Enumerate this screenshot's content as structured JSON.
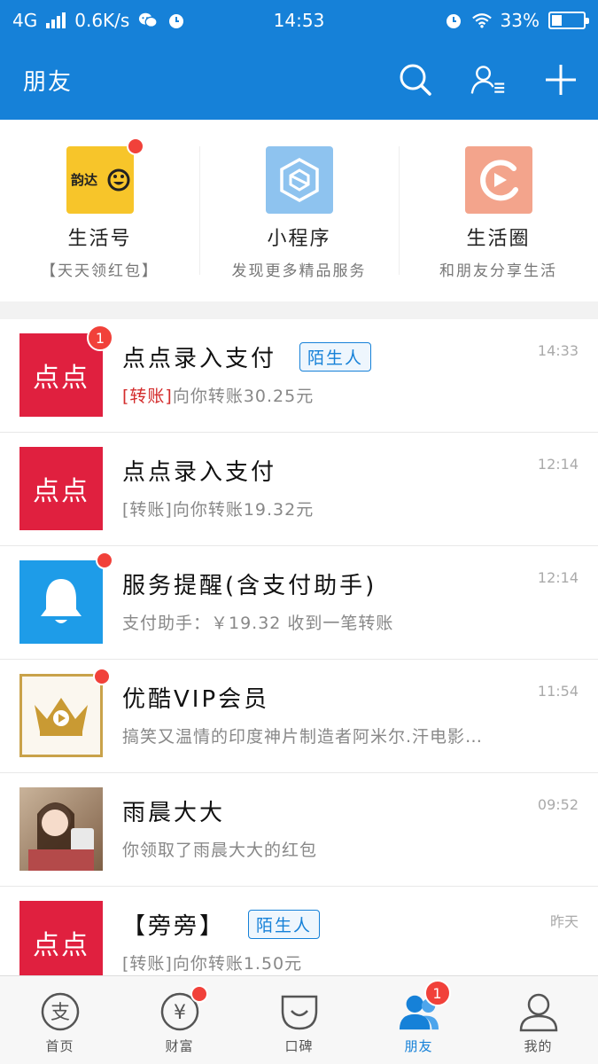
{
  "status_bar": {
    "network": "4G",
    "speed": "0.6K/s",
    "time": "14:53",
    "battery_percent": "33%",
    "battery_level": 0.33
  },
  "header": {
    "title": "朋友"
  },
  "top_grid": [
    {
      "title": "生活号",
      "subtitle": "【天天领红包】",
      "icon": "yunda-logo",
      "has_dot": true
    },
    {
      "title": "小程序",
      "subtitle": "发现更多精品服务",
      "icon": "mini-program-icon",
      "has_dot": false
    },
    {
      "title": "生活圈",
      "subtitle": "和朋友分享生活",
      "icon": "life-circle-icon",
      "has_dot": false
    }
  ],
  "chats": [
    {
      "name": "点点录入支付",
      "tag": "陌生人",
      "msg_prefix": "[转账]",
      "msg": "向你转账30.25元",
      "time": "14:33",
      "badge": "1",
      "avatar_text": "点点"
    },
    {
      "name": "点点录入支付",
      "tag": "",
      "msg_prefix": "",
      "msg": "[转账]向你转账19.32元",
      "time": "12:14",
      "badge": "",
      "avatar_text": "点点"
    },
    {
      "name": "服务提醒(含支付助手)",
      "tag": "",
      "msg_prefix": "",
      "msg": "支付助手：￥19.32 收到一笔转账",
      "time": "12:14",
      "badge": "",
      "avatar_text": ""
    },
    {
      "name": "优酷VIP会员",
      "tag": "",
      "msg_prefix": "",
      "msg": "搞笑又温情的印度神片制造者阿米尔.汗电影…",
      "time": "11:54",
      "badge": "",
      "avatar_text": ""
    },
    {
      "name": "雨晨大大",
      "tag": "",
      "msg_prefix": "",
      "msg": "你领取了雨晨大大的红包",
      "time": "09:52",
      "badge": "",
      "avatar_text": ""
    },
    {
      "name": "【旁旁】",
      "tag": "陌生人",
      "msg_prefix": "",
      "msg": "[转账]向你转账1.50元",
      "time": "昨天",
      "badge": "",
      "avatar_text": "点点"
    }
  ],
  "tabs": [
    {
      "label": "首页",
      "icon": "home-icon",
      "active": false
    },
    {
      "label": "财富",
      "icon": "wealth-icon",
      "active": false
    },
    {
      "label": "口碑",
      "icon": "koubei-icon",
      "active": false
    },
    {
      "label": "朋友",
      "icon": "friends-icon",
      "active": true,
      "badge": "1"
    },
    {
      "label": "我的",
      "icon": "profile-icon",
      "active": false
    }
  ],
  "colors": {
    "brand_blue": "#1681d8",
    "badge_red": "#f1413a",
    "dian_red": "#e0203f",
    "bell_blue": "#1e9ce8"
  }
}
